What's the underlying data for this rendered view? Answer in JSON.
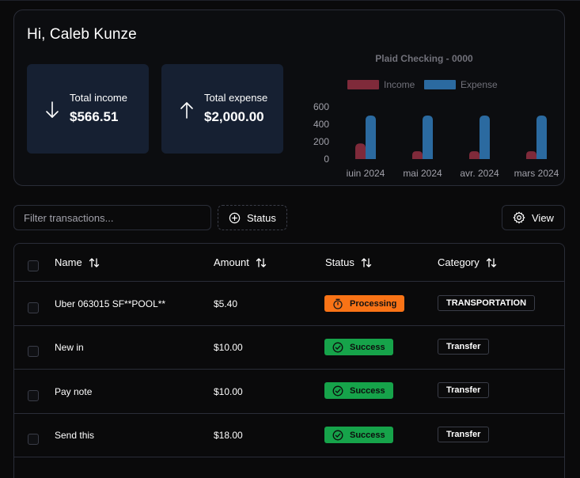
{
  "greeting": "Hi, Caleb Kunze",
  "stats": {
    "income": {
      "label": "Total income",
      "value": "$566.51",
      "icon": "arrow-down-icon"
    },
    "expense": {
      "label": "Total expense",
      "value": "$2,000.00",
      "icon": "arrow-up-icon"
    }
  },
  "chart_data": {
    "type": "bar",
    "title": "Plaid Checking - 0000",
    "categories": [
      "juin 2024",
      "mai 2024",
      "avr. 2024",
      "mars 2024"
    ],
    "series": [
      {
        "name": "Income",
        "values": [
          180,
          90,
          90,
          90
        ],
        "color": "#7f2a3a"
      },
      {
        "name": "Expense",
        "values": [
          500,
          500,
          500,
          500
        ],
        "color": "#2b6aa0"
      }
    ],
    "yticks": [
      "0",
      "200",
      "400",
      "600"
    ],
    "ylim": [
      0,
      700
    ],
    "legend": "top",
    "grid": false
  },
  "toolbar": {
    "filter_placeholder": "Filter transactions...",
    "status_label": "Status",
    "view_label": "View"
  },
  "table": {
    "columns": [
      "Name",
      "Amount",
      "Status",
      "Category"
    ],
    "rows": [
      {
        "name": "Uber 063015 SF**POOL**",
        "amount": "$5.40",
        "status": "Processing",
        "category": "TRANSPORTATION"
      },
      {
        "name": "New in",
        "amount": "$10.00",
        "status": "Success",
        "category": "Transfer"
      },
      {
        "name": "Pay note",
        "amount": "$10.00",
        "status": "Success",
        "category": "Transfer"
      },
      {
        "name": "Send this",
        "amount": "$18.00",
        "status": "Success",
        "category": "Transfer"
      }
    ]
  },
  "colors": {
    "processing": "#f97316",
    "success": "#16a34a",
    "card_bg": "#162032"
  }
}
